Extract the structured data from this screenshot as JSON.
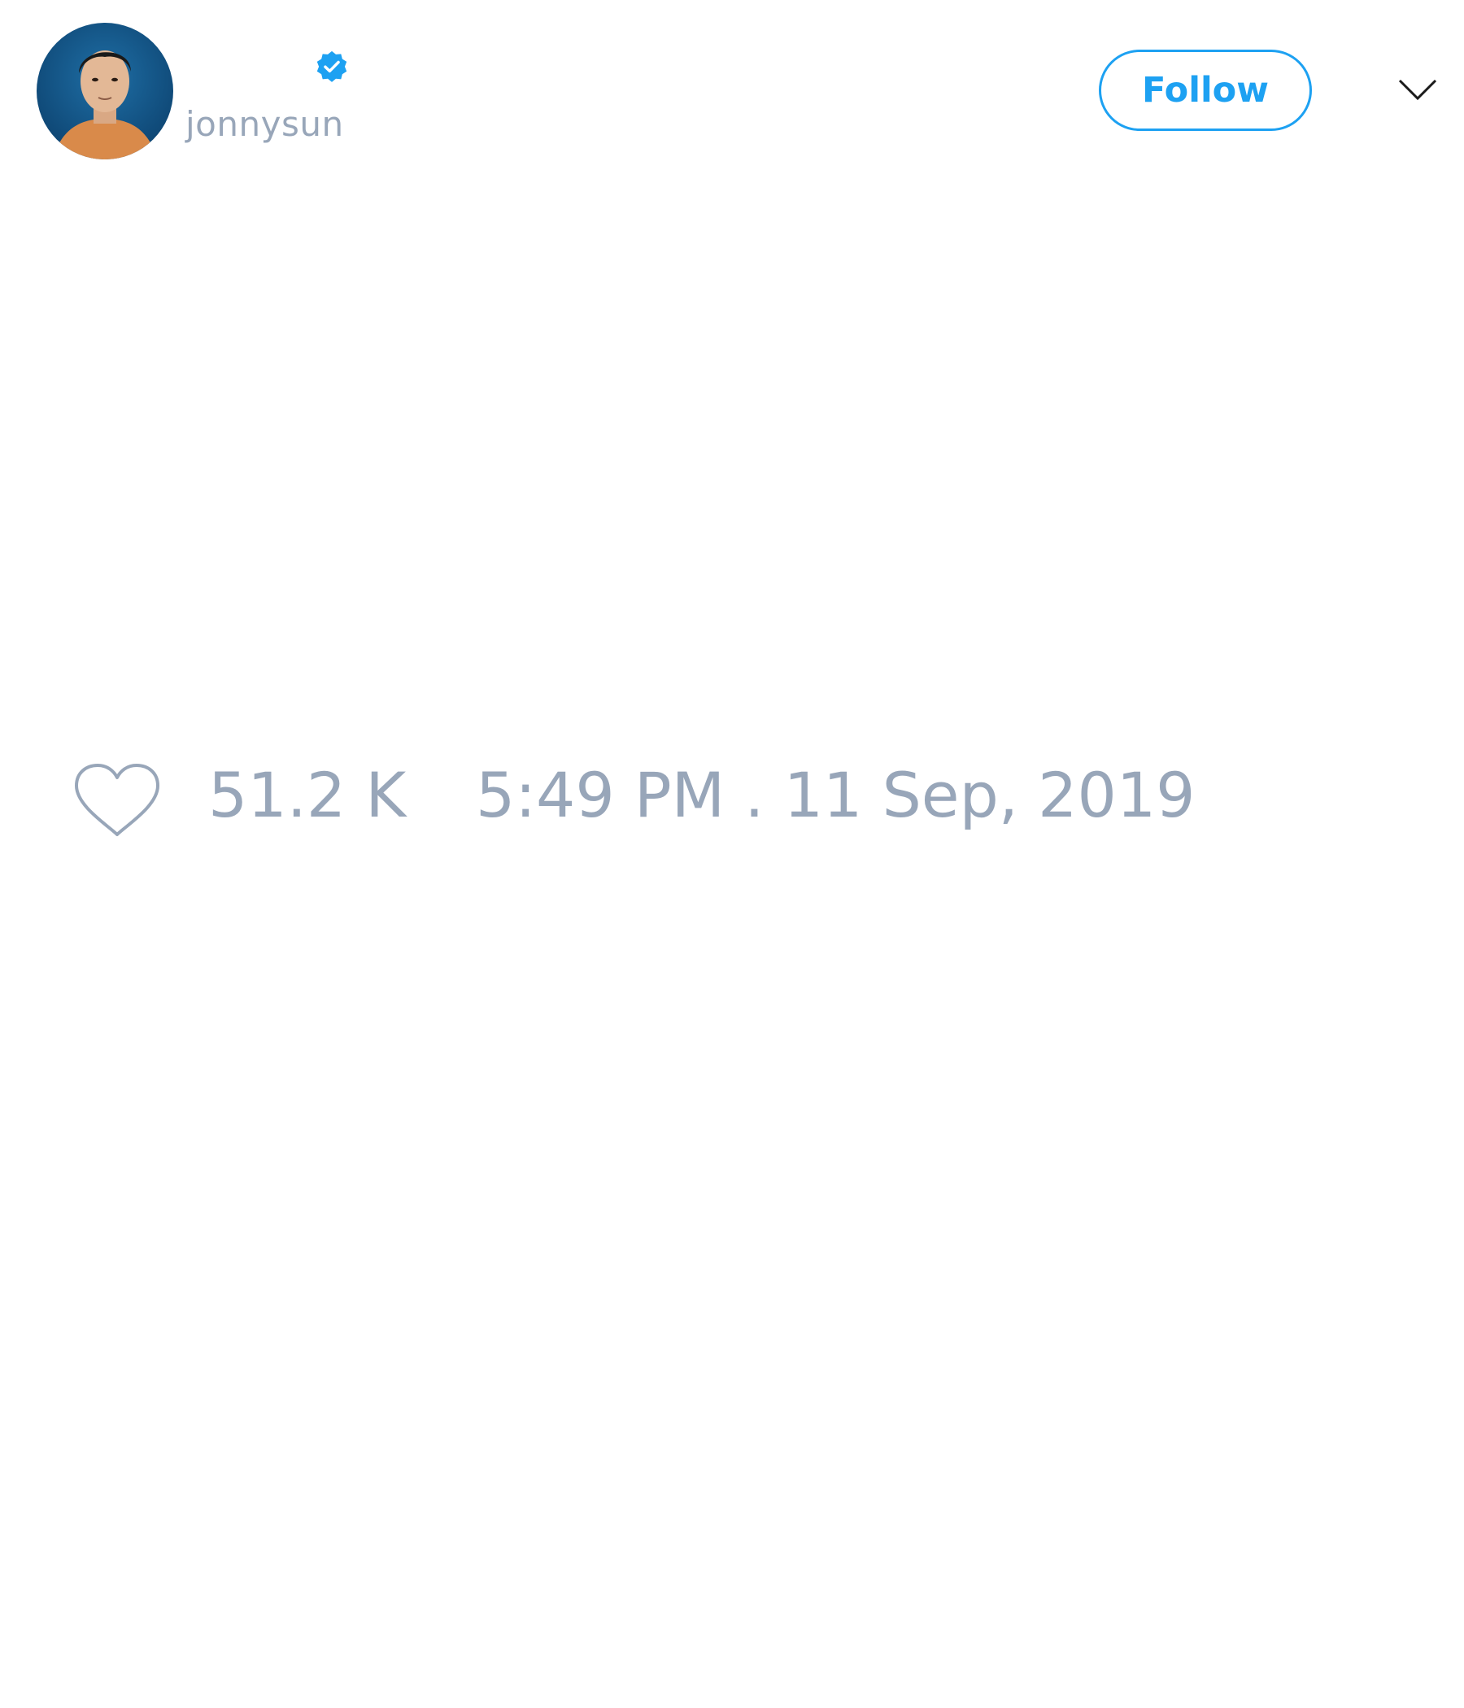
{
  "user": {
    "handle": "jonnysun",
    "verified": true,
    "avatar_icon": "user-avatar"
  },
  "actions": {
    "follow_label": "Follow",
    "menu_icon": "chevron-down-icon"
  },
  "tweet": {
    "like_icon": "heart-icon",
    "like_count": "51.2 K",
    "timestamp": "5:49 PM . 11 Sep, 2019"
  },
  "colors": {
    "accent": "#1da1f2",
    "muted_text": "#98a6b9",
    "background": "#ffffff"
  }
}
